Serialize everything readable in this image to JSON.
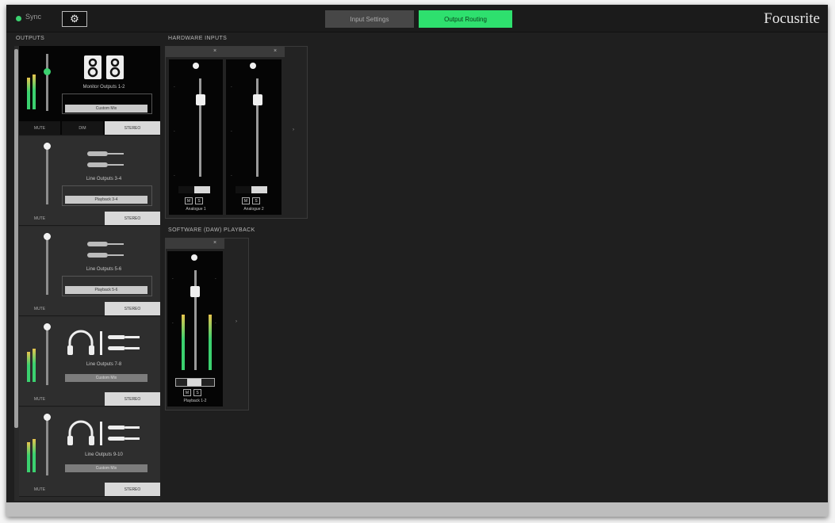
{
  "topbar": {
    "sync_label": "Sync",
    "settings_glyph": "⚙",
    "tabs": [
      {
        "label": "Input Settings",
        "active": false
      },
      {
        "label": "Output Routing",
        "active": true
      }
    ],
    "brand": "Focusrite"
  },
  "sections": {
    "outputs": "OUTPUTS",
    "hardware_inputs": "HARDWARE INPUTS",
    "software_playback": "SOFTWARE (DAW) PLAYBACK"
  },
  "outputs": [
    {
      "name": "Monitor Outputs 1-2",
      "source": "Custom Mix",
      "buttons": [
        "MUTE",
        "DIM",
        "STEREO"
      ],
      "selected": true,
      "icon": "monitor-speakers-icon"
    },
    {
      "name": "Line Outputs 3-4",
      "source": "Playback 3-4",
      "buttons": [
        "MUTE",
        "STEREO"
      ],
      "selected": false,
      "icon": "line-cable-icon"
    },
    {
      "name": "Line Outputs 5-6",
      "source": "Playback 5-6",
      "buttons": [
        "MUTE",
        "STEREO"
      ],
      "selected": false,
      "icon": "line-cable-icon"
    },
    {
      "name": "Line Outputs 7-8",
      "source": "Custom Mix",
      "buttons": [
        "MUTE",
        "STEREO"
      ],
      "selected": false,
      "icon": "headphones-icon"
    },
    {
      "name": "Line Outputs 9-10",
      "source": "Custom Mix",
      "buttons": [
        "MUTE",
        "STEREO"
      ],
      "selected": false,
      "icon": "headphones-icon"
    }
  ],
  "hardware_inputs": [
    {
      "name": "Analogue 1",
      "close": "×"
    },
    {
      "name": "Analogue 2",
      "close": "×"
    }
  ],
  "software_playback": [
    {
      "name": "Playback 1-2",
      "close": "×"
    }
  ],
  "mix_controls": {
    "mute": "M",
    "solo": "S"
  },
  "colors": {
    "accent_green": "#2ee06e",
    "meter_green": "#3bd16f",
    "meter_yellow": "#e8c44d"
  }
}
